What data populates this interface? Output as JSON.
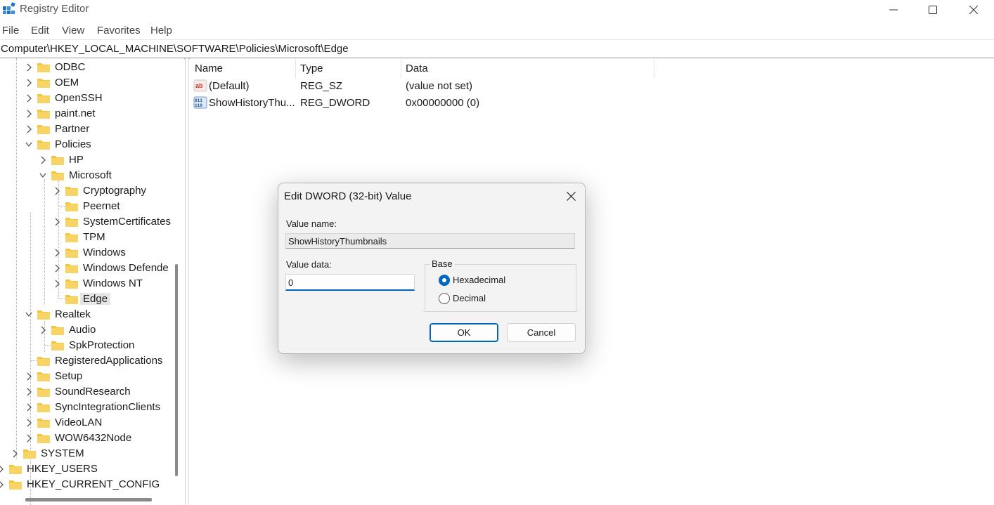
{
  "window": {
    "title": "Registry Editor"
  },
  "menu": [
    "File",
    "Edit",
    "View",
    "Favorites",
    "Help"
  ],
  "address": "Computer\\HKEY_LOCAL_MACHINE\\SOFTWARE\\Policies\\Microsoft\\Edge",
  "tree": {
    "items": [
      {
        "label": "ODBC"
      },
      {
        "label": "OEM"
      },
      {
        "label": "OpenSSH"
      },
      {
        "label": "paint.net"
      },
      {
        "label": "Partner"
      },
      {
        "label": "Policies",
        "expanded": true
      },
      {
        "label": "HP"
      },
      {
        "label": "Microsoft",
        "expanded": true
      },
      {
        "label": "Cryptography"
      },
      {
        "label": "Peernet"
      },
      {
        "label": "SystemCertificates"
      },
      {
        "label": "TPM"
      },
      {
        "label": "Windows"
      },
      {
        "label": "Windows Defende"
      },
      {
        "label": "Windows NT"
      },
      {
        "label": "Edge",
        "selected": true
      },
      {
        "label": "Realtek",
        "expanded": true
      },
      {
        "label": "Audio"
      },
      {
        "label": "SpkProtection"
      },
      {
        "label": "RegisteredApplications"
      },
      {
        "label": "Setup"
      },
      {
        "label": "SoundResearch"
      },
      {
        "label": "SyncIntegrationClients"
      },
      {
        "label": "VideoLAN"
      },
      {
        "label": "WOW6432Node"
      },
      {
        "label": "SYSTEM"
      },
      {
        "label": "HKEY_USERS"
      },
      {
        "label": "HKEY_CURRENT_CONFIG"
      }
    ]
  },
  "list": {
    "columns": [
      "Name",
      "Type",
      "Data"
    ],
    "rows": [
      {
        "name": "(Default)",
        "type": "REG_SZ",
        "data": "(value not set)",
        "icon": "string-value-icon"
      },
      {
        "name": "ShowHistoryThu...",
        "type": "REG_DWORD",
        "data": "0x00000000 (0)",
        "icon": "binary-value-icon"
      }
    ]
  },
  "dialog": {
    "title": "Edit DWORD (32-bit) Value",
    "value_name_label": "Value name:",
    "value_name": "ShowHistoryThumbnails",
    "value_data_label": "Value data:",
    "value_data": "0",
    "base_label": "Base",
    "base_options": [
      {
        "label": "Hexadecimal",
        "selected": true
      },
      {
        "label": "Decimal",
        "selected": false
      }
    ],
    "ok_label": "OK",
    "cancel_label": "Cancel"
  },
  "colors": {
    "accent": "#0067c0",
    "folder": "#f4c43a",
    "selection": "#e5e5e5"
  }
}
